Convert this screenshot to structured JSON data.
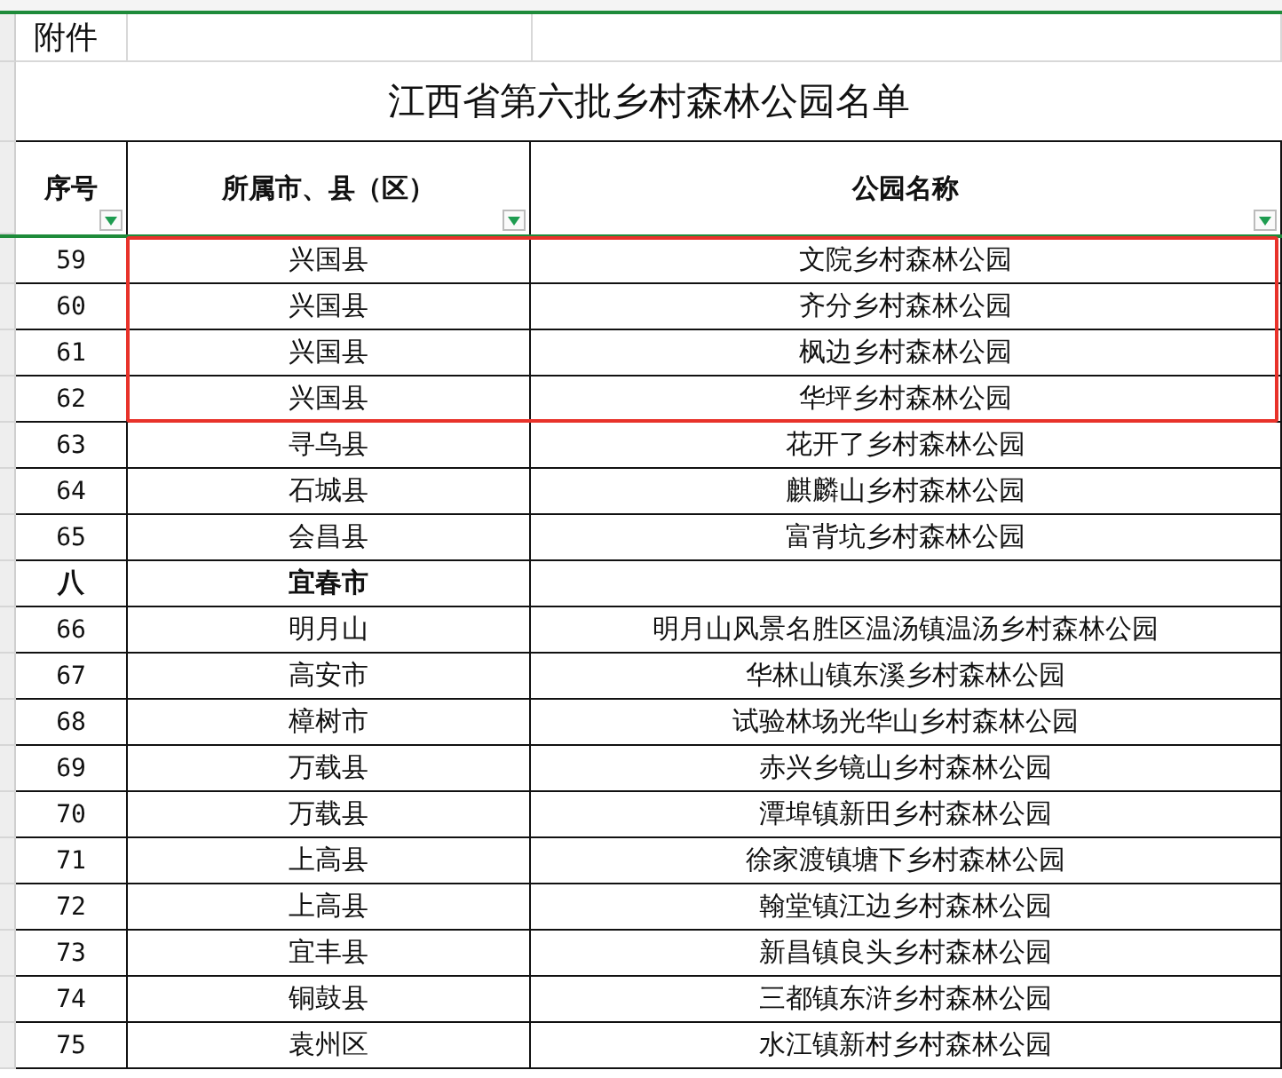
{
  "attachment_label": "附件",
  "title": "江西省第六批乡村森林公园名单",
  "table": {
    "columns": [
      {
        "label": "序号",
        "filter": true
      },
      {
        "label": "所属市、县（区）",
        "filter": true
      },
      {
        "label": "公园名称",
        "filter": true
      }
    ],
    "rows": [
      {
        "kind": "item",
        "no": "59",
        "county": "兴国县",
        "park": "文院乡村森林公园",
        "highlighted": true
      },
      {
        "kind": "item",
        "no": "60",
        "county": "兴国县",
        "park": "齐分乡村森林公园",
        "highlighted": true
      },
      {
        "kind": "item",
        "no": "61",
        "county": "兴国县",
        "park": "枫边乡村森林公园",
        "highlighted": true
      },
      {
        "kind": "item",
        "no": "62",
        "county": "兴国县",
        "park": "华坪乡村森林公园",
        "highlighted": true
      },
      {
        "kind": "item",
        "no": "63",
        "county": "寻乌县",
        "park": "花开了乡村森林公园",
        "highlighted": false
      },
      {
        "kind": "item",
        "no": "64",
        "county": "石城县",
        "park": "麒麟山乡村森林公园",
        "highlighted": false
      },
      {
        "kind": "item",
        "no": "65",
        "county": "会昌县",
        "park": "富背坑乡村森林公园",
        "highlighted": false
      },
      {
        "kind": "group",
        "no": "八",
        "county": "宜春市",
        "highlighted": false
      },
      {
        "kind": "item",
        "no": "66",
        "county": "明月山",
        "park": "明月山风景名胜区温汤镇温汤乡村森林公园",
        "highlighted": false
      },
      {
        "kind": "item",
        "no": "67",
        "county": "高安市",
        "park": "华林山镇东溪乡村森林公园",
        "highlighted": false
      },
      {
        "kind": "item",
        "no": "68",
        "county": "樟树市",
        "park": "试验林场光华山乡村森林公园",
        "highlighted": false
      },
      {
        "kind": "item",
        "no": "69",
        "county": "万载县",
        "park": "赤兴乡镜山乡村森林公园",
        "highlighted": false
      },
      {
        "kind": "item",
        "no": "70",
        "county": "万载县",
        "park": "潭埠镇新田乡村森林公园",
        "highlighted": false
      },
      {
        "kind": "item",
        "no": "71",
        "county": "上高县",
        "park": "徐家渡镇塘下乡村森林公园",
        "highlighted": false
      },
      {
        "kind": "item",
        "no": "72",
        "county": "上高县",
        "park": "翰堂镇江边乡村森林公园",
        "highlighted": false
      },
      {
        "kind": "item",
        "no": "73",
        "county": "宜丰县",
        "park": "新昌镇良头乡村森林公园",
        "highlighted": false
      },
      {
        "kind": "item",
        "no": "74",
        "county": "铜鼓县",
        "park": "三都镇东浒乡村森林公园",
        "highlighted": false
      },
      {
        "kind": "item",
        "no": "75",
        "county": "袁州区",
        "park": "水江镇新村乡村森林公园",
        "highlighted": false
      }
    ]
  }
}
